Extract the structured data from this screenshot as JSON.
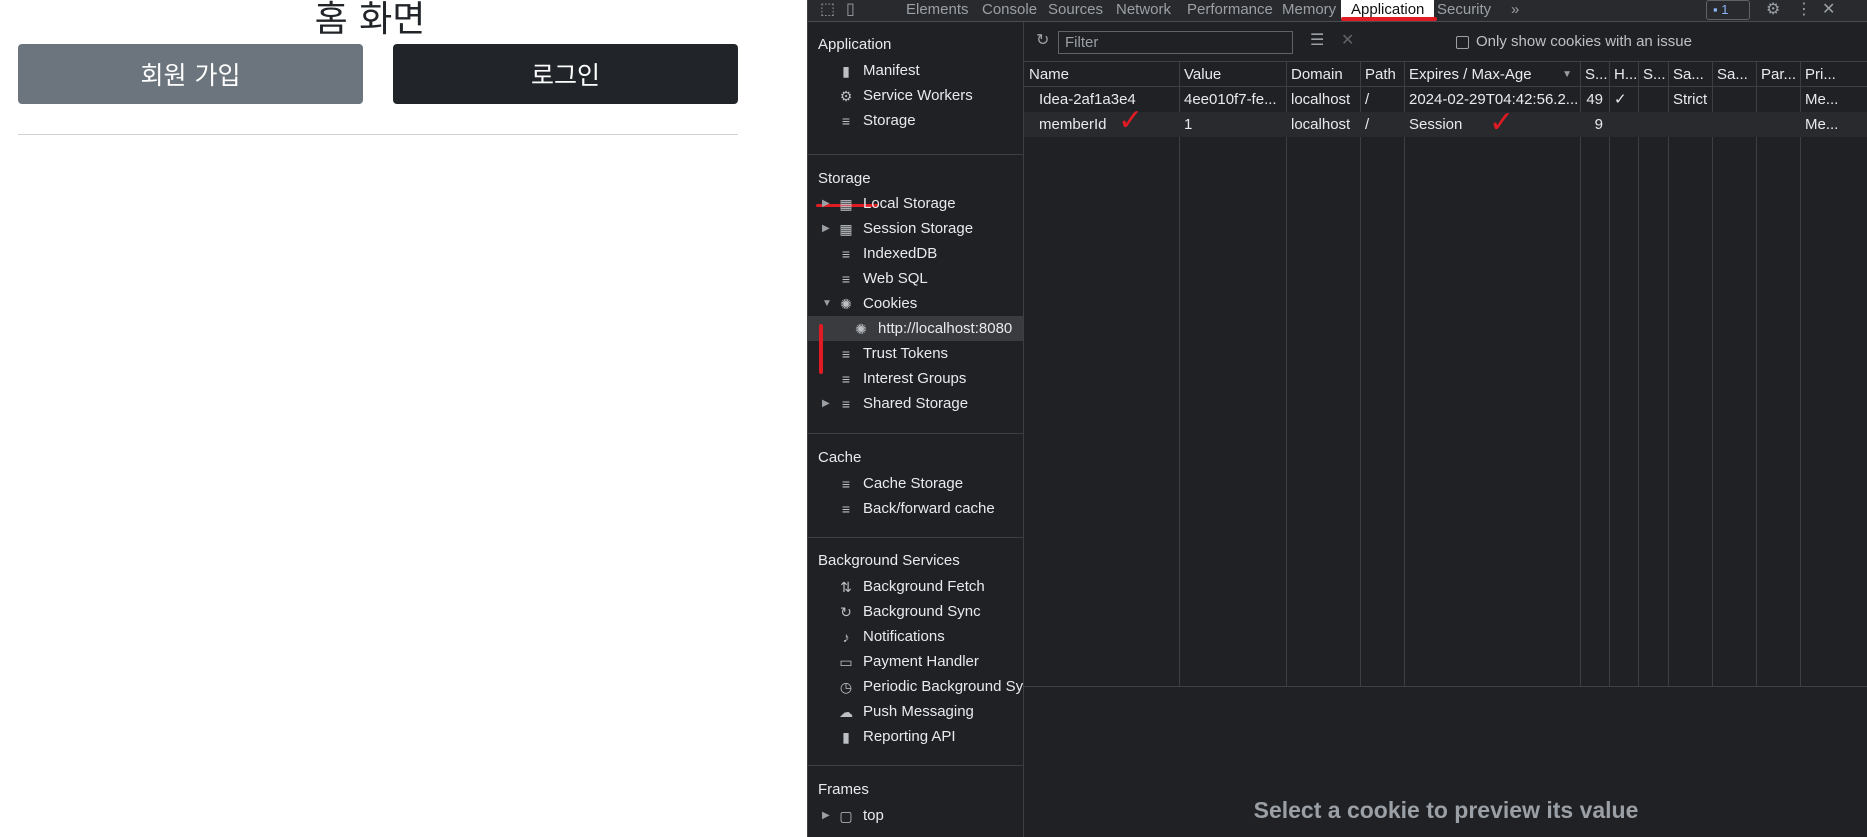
{
  "webpage": {
    "title": "홈 화면",
    "signup_label": "회원 가입",
    "login_label": "로그인"
  },
  "devtools": {
    "tabs": [
      "Elements",
      "Console",
      "Sources",
      "Network",
      "Performance",
      "Memory",
      "Application",
      "Security"
    ],
    "active_tab": "Application",
    "more_tabs": "»",
    "issues_count": "1",
    "sidebar": {
      "application_title": "Application",
      "application_items": [
        "Manifest",
        "Service Workers",
        "Storage"
      ],
      "storage_title": "Storage",
      "storage_items": [
        "Local Storage",
        "Session Storage",
        "IndexedDB",
        "Web SQL",
        "Cookies"
      ],
      "cookie_origin": "http://localhost:8080",
      "storage_items_after": [
        "Trust Tokens",
        "Interest Groups",
        "Shared Storage"
      ],
      "cache_title": "Cache",
      "cache_items": [
        "Cache Storage",
        "Back/forward cache"
      ],
      "bg_title": "Background Services",
      "bg_items": [
        "Background Fetch",
        "Background Sync",
        "Notifications",
        "Payment Handler",
        "Periodic Background Sync",
        "Push Messaging",
        "Reporting API"
      ],
      "frames_title": "Frames",
      "frames_items": [
        "top"
      ]
    },
    "toolbar": {
      "filter_placeholder": "Filter",
      "only_issue_label": "Only show cookies with an issue"
    },
    "table": {
      "headers": [
        "Name",
        "Value",
        "Domain",
        "Path",
        "Expires / Max-Age",
        "S...",
        "H...",
        "S...",
        "Sa...",
        "Sa...",
        "Par...",
        "Pri..."
      ],
      "rows": [
        [
          "Idea-2af1a3e4",
          "4ee010f7-fe...",
          "localhost",
          "/",
          "2024-02-29T04:42:56.2...",
          "49",
          "✓",
          "",
          "Strict",
          "",
          "",
          "Me..."
        ],
        [
          "memberId",
          "1",
          "localhost",
          "/",
          "Session",
          "9",
          "",
          "",
          "",
          "",
          "",
          "Me..."
        ]
      ]
    },
    "preview_text": "Select a cookie to preview its value"
  },
  "colors": {
    "accent_red": "#e01b24",
    "devtools_bg": "#202124",
    "signup_bg": "#6c757d",
    "login_bg": "#212529"
  }
}
